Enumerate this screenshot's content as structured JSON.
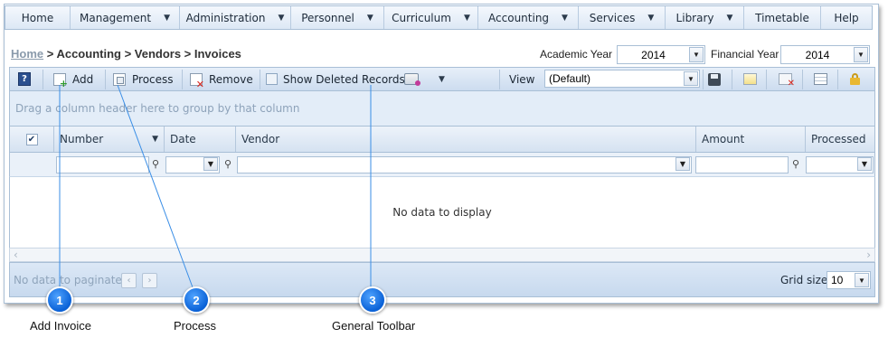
{
  "menu": {
    "items": [
      {
        "label": "Home",
        "caret": false
      },
      {
        "label": "Management",
        "caret": true
      },
      {
        "label": "Administration",
        "caret": true
      },
      {
        "label": "Personnel",
        "caret": true
      },
      {
        "label": "Curriculum",
        "caret": true
      },
      {
        "label": "Accounting",
        "caret": true
      },
      {
        "label": "Services",
        "caret": true
      },
      {
        "label": "Library",
        "caret": true
      },
      {
        "label": "Timetable",
        "caret": false
      },
      {
        "label": "Help",
        "caret": false
      }
    ]
  },
  "breadcrumb": {
    "home": "Home",
    "path": " > Accounting > Vendors > Invoices"
  },
  "academic_year": {
    "label": "Academic Year",
    "value": "2014"
  },
  "financial_year": {
    "label": "Financial Year",
    "value": "2014"
  },
  "toolbar": {
    "add": "Add",
    "process": "Process",
    "remove": "Remove",
    "show_deleted": "Show Deleted Records",
    "view_label": "View",
    "view_value": "(Default)"
  },
  "grid": {
    "group_hint": "Drag a column header here to group by that column",
    "columns": [
      "Number",
      "Date",
      "Vendor",
      "Amount",
      "Processed"
    ],
    "empty_text": "No data to display",
    "pager_text": "No data to paginate",
    "grid_size_label": "Grid size:",
    "grid_size_value": "10"
  },
  "callouts": [
    {
      "number": "1",
      "label": "Add Invoice"
    },
    {
      "number": "2",
      "label": "Process"
    },
    {
      "number": "3",
      "label": "General Toolbar"
    }
  ],
  "colors": {
    "callout": "#0a61d6",
    "toolbar": "#ccdcef",
    "border": "#a9bfd6"
  }
}
